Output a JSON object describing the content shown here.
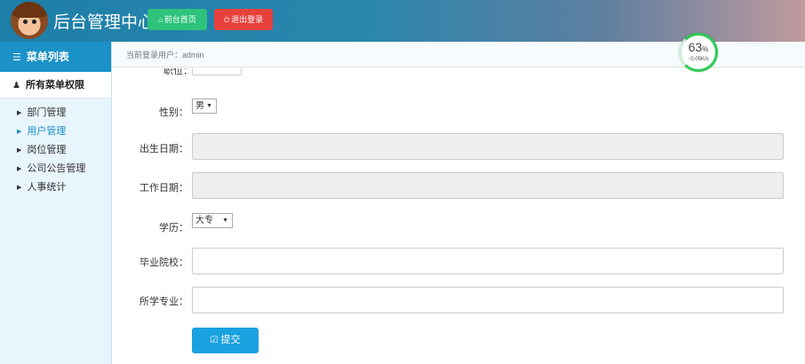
{
  "header": {
    "title": "后台管理中心",
    "home_button": "前台首页",
    "logout_button": "退出登录",
    "home_icon": "home-icon",
    "logout_icon": "power-icon"
  },
  "sidebar": {
    "menu_list_label": "菜单列表",
    "permissions_label": "所有菜单权限",
    "items": [
      {
        "label": "部门管理",
        "active": false
      },
      {
        "label": "用户管理",
        "active": true
      },
      {
        "label": "岗位管理",
        "active": false
      },
      {
        "label": "公司公告管理",
        "active": false
      },
      {
        "label": "人事统计",
        "active": false
      }
    ]
  },
  "breadcrumb": {
    "current_user": "当前登录用户：admin"
  },
  "speed_widget": {
    "percent": "63",
    "percent_unit": "%",
    "rate": "↑0.05K/s"
  },
  "form": {
    "cut_label": "职位：",
    "gender_label": "性别：",
    "gender_value": "男",
    "birth_label": "出生日期：",
    "work_label": "工作日期：",
    "education_label": "学历：",
    "education_value": "大专",
    "school_label": "毕业院校：",
    "major_label": "所学专业：",
    "submit_label": "提交"
  },
  "colors": {
    "accent": "#1a91c7",
    "home_button": "#2ec27c",
    "logout_button": "#e8413d",
    "submit_button": "#1aa1e0"
  }
}
